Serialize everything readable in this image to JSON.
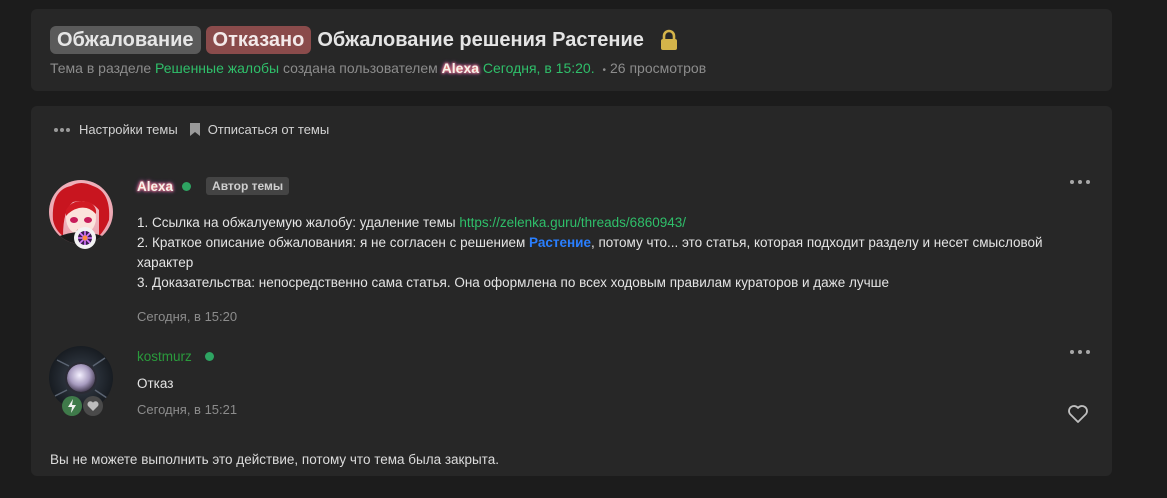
{
  "thread": {
    "prefix_1": "Обжалование",
    "prefix_2": "Отказано",
    "title": "Обжалование решения Растение",
    "meta": {
      "text_1": "Тема в разделе",
      "section": "Решенные жалобы",
      "text_2": "создана пользователем",
      "author": "Alexa",
      "date": "Сегодня, в 15:20.",
      "separator": "•",
      "views": "26 просмотров"
    }
  },
  "controls": {
    "settings_label": "Настройки темы",
    "unsubscribe_label": "Отписаться от темы"
  },
  "posts": [
    {
      "author": "Alexa",
      "badge": "Автор темы",
      "line_1_text": "1. Ссылка на обжалуемую жалобу: удаление темы",
      "line_1_link": "https://zelenka.guru/threads/6860943/",
      "line_2_text_a": "2. Краткое описание обжалования: я не согласен с решением",
      "line_2_link": "Растение",
      "line_2_text_b": ", потому что... это статья, которая подходит разделу и несет смысловой характер",
      "line_3_text": "3. Доказательства: непосредственно сама статья. Она оформлена по всех ходовым правилам кураторов и даже лучше",
      "date": "Сегодня, в 15:20"
    },
    {
      "author": "kostmurz",
      "message": "Отказ",
      "date": "Сегодня, в 15:21"
    }
  ],
  "closed_note": "Вы не можете выполнить это действие, потому что тема была закрыта.",
  "colors": {
    "accent_green": "#2fbf6a",
    "link_blue": "#2a7fff",
    "prefix_grey": "#5a5a5a",
    "prefix_red": "#8a4b4b",
    "lock_gold": "#d4b44a"
  }
}
